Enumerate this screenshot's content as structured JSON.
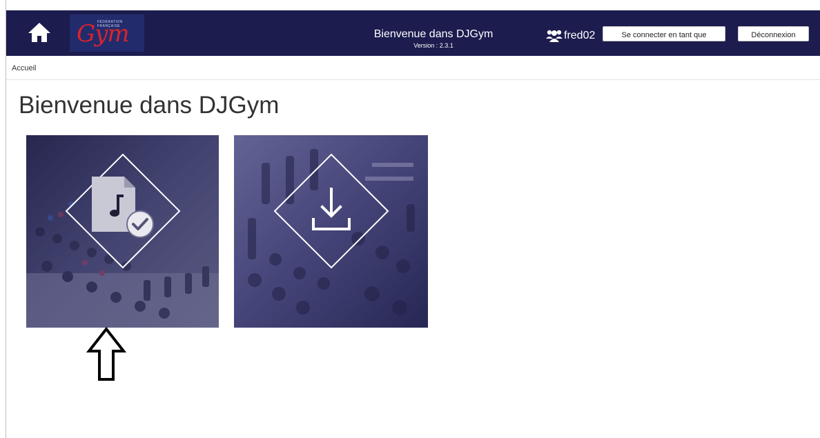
{
  "header": {
    "app_title": "Bienvenue dans DJGym",
    "version": "Version : 2.3.1",
    "logo_text": "Gym",
    "logo_small_text": "FÉDÉRATION FRANÇAISE",
    "username": "fred02",
    "impersonate_label": "Se connecter en tant que",
    "logout_label": "Déconnexion"
  },
  "breadcrumb": {
    "home": "Accueil"
  },
  "main": {
    "title": "Bienvenue dans DJGym",
    "tiles": [
      {
        "icon": "music-file-check-icon"
      },
      {
        "icon": "download-icon"
      }
    ]
  },
  "colors": {
    "header_bg": "#1c1c4f",
    "tile_overlay": "#3a3a78",
    "logo_red": "#d9232f"
  }
}
